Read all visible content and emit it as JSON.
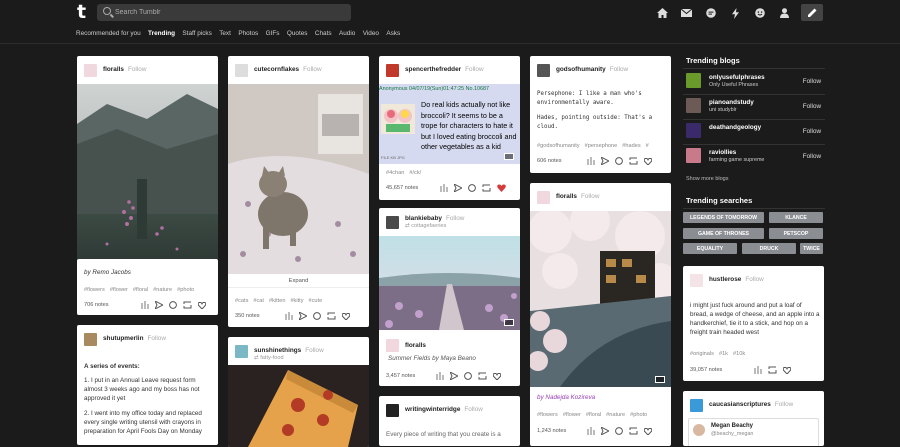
{
  "topbar": {
    "logo": "t",
    "search_placeholder": "Search Tumblr",
    "icons": [
      "home-icon",
      "mail-icon",
      "chat-icon",
      "lightning-icon",
      "smiley-icon",
      "person-icon",
      "pencil-icon"
    ]
  },
  "subnav": {
    "tabs": [
      "Recommended for you",
      "Trending",
      "Staff picks",
      "Text",
      "Photos",
      "GIFs",
      "Quotes",
      "Chats",
      "Audio",
      "Video",
      "Asks"
    ],
    "active": "Trending"
  },
  "follow_label": "Follow",
  "posts": {
    "floralls1": {
      "user": "floralls",
      "caption": "by Remo Jacobs",
      "tags": [
        "#flowers",
        "#flower",
        "#floral",
        "#nature",
        "#photo"
      ],
      "notes": "706 notes"
    },
    "shutupmerlin": {
      "user": "shutupmerlin",
      "heading": "A series of events:",
      "items": [
        "1. I put in an Annual Leave request form almost 3 weeks ago and my boss has not approved it yet",
        "2. I went into my office today and replaced every single writing utensil with crayons in preparation for April Fools Day on Monday"
      ]
    },
    "cutecornflakes": {
      "user": "cutecornflakes",
      "expand": "Expand",
      "tags": [
        "#cats",
        "#cat",
        "#kitten",
        "#kitty",
        "#cute"
      ],
      "notes": "350 notes"
    },
    "sunshinethings": {
      "user": "sunshinethings",
      "sub": "fatty-food"
    },
    "spencer": {
      "user": "spencerthefredder",
      "chan_header": "Anonymous 04/07/19(Sun)01:47:25 No.10687",
      "chan_text": "Do real kids actually not like broccoli? It seems to be a trope for characters to hate it but I loved eating broccoli and other vegetables as a kid",
      "file_label": "FILE KB JPG",
      "tags": [
        "#4chan",
        "#/ck/"
      ],
      "notes": "45,657 notes"
    },
    "blankiebaby": {
      "user": "blankiebaby",
      "sub": "cottagefaeries"
    },
    "floralls3": {
      "user": "floralls",
      "caption": "Summer Fields by Maya Beano",
      "notes": "3,457 notes"
    },
    "writingwinterridge": {
      "user": "writingwinterridge",
      "body": "Every piece of writing that you create is a"
    },
    "godsofhumanity": {
      "user": "godsofhumanity",
      "lines": [
        "Persephone:  I like a man who's environmentally aware.",
        "Hades, pointing outside:  That's a cloud."
      ],
      "tags": [
        "#godsofhumanity",
        "#persephone",
        "#hades",
        "#"
      ],
      "notes": "606 notes"
    },
    "floralls2": {
      "user": "floralls",
      "caption": "by Nadejda Kozireva",
      "tags": [
        "#flowers",
        "#flower",
        "#floral",
        "#nature",
        "#photo"
      ],
      "notes": "1,243 notes"
    },
    "hustlerose": {
      "user": "hustlerose",
      "body": "i might just fuck around and put a loaf of bread, a wedge of cheese, and an apple into a handkerchief, tie it to a stick, and hop on a freight train headed west",
      "tags": [
        "#originals",
        "#1k",
        "#10k"
      ],
      "notes": "39,057 notes"
    },
    "caucasianscriptures": {
      "user": "caucasianscriptures",
      "inner_name": "Megan Beachy",
      "inner_handle": "@beachy_megan"
    }
  },
  "sidebar": {
    "trending_blogs_title": "Trending blogs",
    "blogs": [
      {
        "name": "onlyusefulphrases",
        "title": "Only Useful Phrases",
        "color": "#6a9a2a"
      },
      {
        "name": "pianoandstudy",
        "title": "uni studyblr",
        "color": "#6b5a55"
      },
      {
        "name": "deathandgeology",
        "title": "",
        "color": "#3a2a6a"
      },
      {
        "name": "raviollies",
        "title": "farming game supreme",
        "color": "#c97a8a"
      }
    ],
    "show_more": "Show more blogs",
    "trending_searches_title": "Trending searches",
    "searches": [
      "LEGENDS OF TOMORROW",
      "KLANCE",
      "GAME OF THRONES",
      "PETSCOP",
      "EQUALITY",
      "DRUCK",
      "TWICE"
    ]
  },
  "colors": {
    "background": "#1b1b1b",
    "card": "#ffffff",
    "tag_chip": "#8a8d92",
    "like_red": "#d63a3a",
    "chan_header": "#7799cc",
    "chan_bg": "#d6daf0",
    "link_purple": "#9b3fb5"
  }
}
